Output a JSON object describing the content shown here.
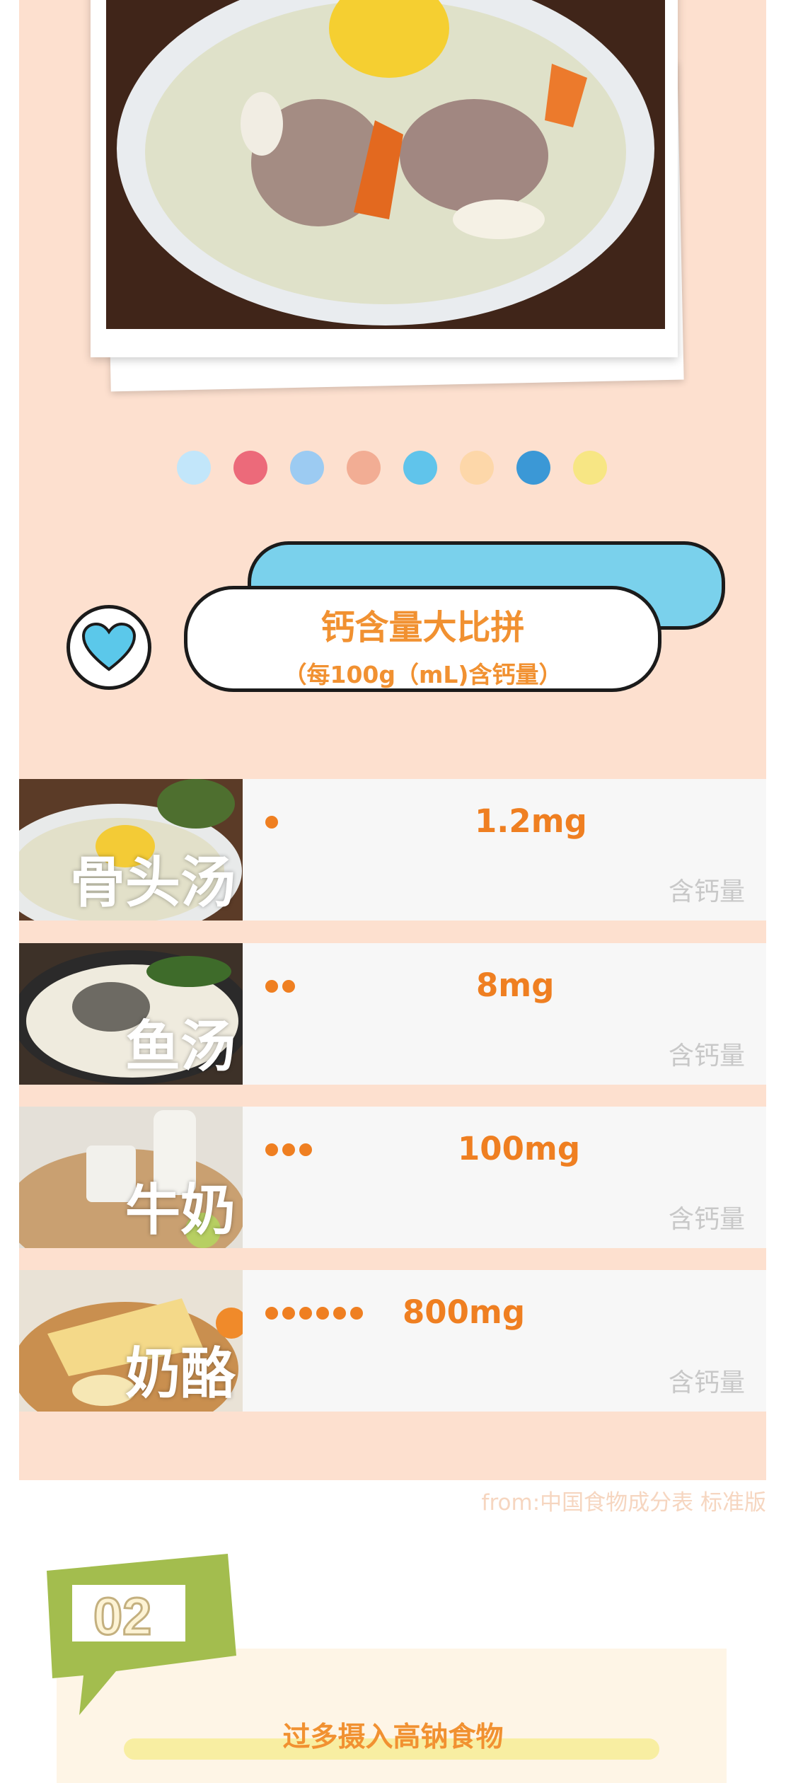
{
  "palette_dots": [
    "#c2e6fa",
    "#ec6a7a",
    "#9ccbf2",
    "#f2ad94",
    "#60c4eb",
    "#fdd7a9",
    "#3b98d6",
    "#f7e684"
  ],
  "banner": {
    "title": "钙含量大比拼",
    "subtitle": "（每100g（mL)含钙量）"
  },
  "rows": [
    {
      "name": "骨头汤",
      "dots": 1,
      "value": "1.2mg",
      "label": "含钙量"
    },
    {
      "name": "鱼汤",
      "dots": 2,
      "value": "8mg",
      "label": "含钙量"
    },
    {
      "name": "牛奶",
      "dots": 3,
      "value": "100mg",
      "label": "含钙量"
    },
    {
      "name": "奶酪",
      "dots": 6,
      "value": "800mg",
      "label": "含钙量"
    }
  ],
  "source": "from:中国食物成分表 标准版",
  "section": {
    "number": "02",
    "title": "过多摄入高钠食物"
  }
}
